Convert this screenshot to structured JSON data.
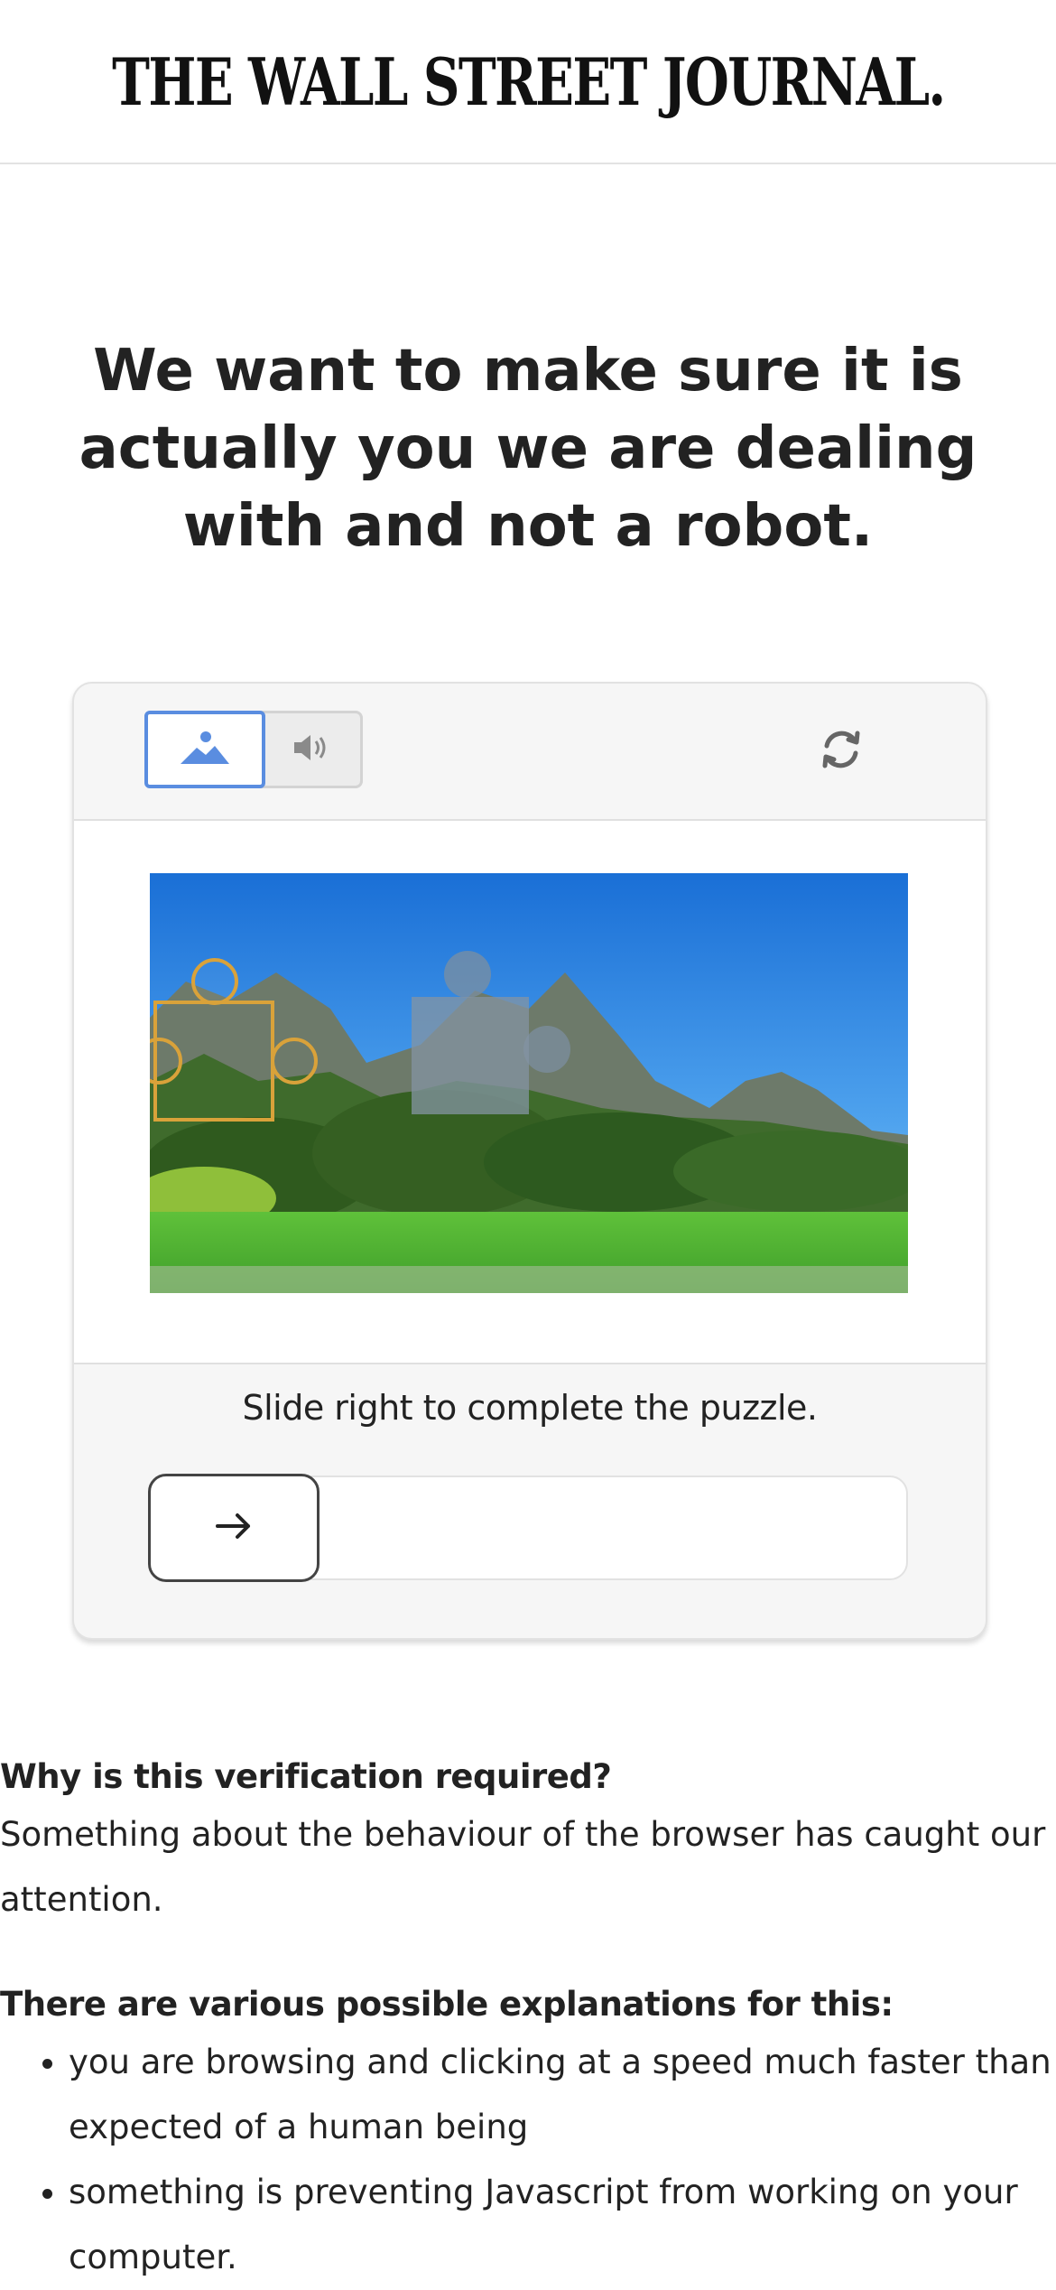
{
  "header": {
    "masthead": "THE WALL STREET JOURNAL."
  },
  "headline": "We want to make sure it is actually you we are dealing with and not a robot.",
  "captcha": {
    "mode_icons": [
      "image-icon",
      "audio-icon"
    ],
    "selected_mode": "image",
    "refresh_icon": "refresh-icon",
    "instruction": "Slide right to complete the puzzle.",
    "slider_icon": "arrow-right-icon",
    "accent_color": "#5a8de0",
    "slider_progress": 0
  },
  "info": {
    "q1_heading": "Why is this verification required?",
    "q1_text": "Something about the behaviour of the browser has caught our attention.",
    "q2_heading": "There are various possible explanations for this:",
    "reasons": [
      "you are browsing and clicking at a speed much faster than expected of a human being",
      "something is preventing Javascript from working on your computer."
    ]
  }
}
